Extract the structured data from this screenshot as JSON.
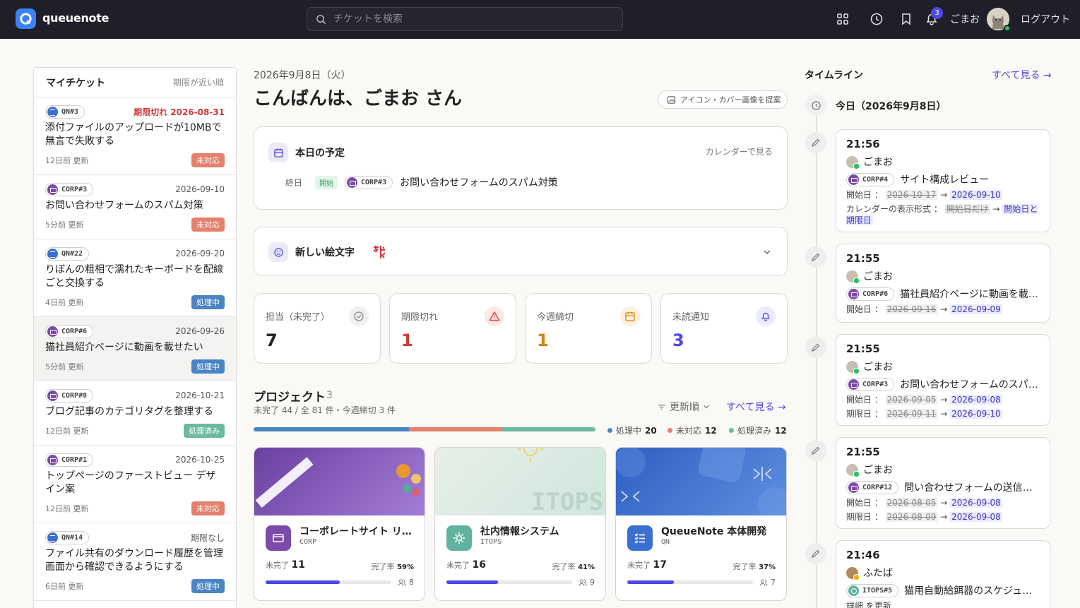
{
  "header": {
    "brand": "queuenote",
    "search_placeholder": "チケットを検索",
    "notif_count": "3",
    "user": "ごまお",
    "logout": "ログアウト"
  },
  "my_tickets": {
    "title": "マイチケット",
    "sort": "期限が近い順",
    "items": [
      {
        "code": "QN#3",
        "project": "qn",
        "date": "期限切れ 2026-08-31",
        "overdue": true,
        "title": "添付ファイルのアップロードが10MBで無言で失敗する",
        "updated": "12日前 更新",
        "status": "未対応",
        "status_kind": "todo"
      },
      {
        "code": "CORP#3",
        "project": "corp",
        "date": "2026-09-10",
        "title": "お問い合わせフォームのスパム対策",
        "updated": "5分前 更新",
        "status": "未対応",
        "status_kind": "todo"
      },
      {
        "code": "QN#22",
        "project": "qn",
        "date": "2026-09-20",
        "title": "りぼんの粗相で濡れたキーボードを配線ごと交換する",
        "updated": "4日前 更新",
        "status": "処理中",
        "status_kind": "prog"
      },
      {
        "code": "CORP#6",
        "project": "corp",
        "date": "2026-09-26",
        "title": "猫社員紹介ページに動画を載せたい",
        "updated": "5分前 更新",
        "status": "処理中",
        "status_kind": "prog",
        "active": true
      },
      {
        "code": "CORP#8",
        "project": "corp",
        "date": "2026-10-21",
        "title": "ブログ記事のカテゴリタグを整理する",
        "updated": "12日前 更新",
        "status": "処理済み",
        "status_kind": "done"
      },
      {
        "code": "CORP#1",
        "project": "corp",
        "date": "2026-10-25",
        "title": "トップページのファーストビュー デザイン案",
        "updated": "12日前 更新",
        "status": "未対応",
        "status_kind": "todo"
      },
      {
        "code": "QN#14",
        "project": "qn",
        "date": "期限なし",
        "title": "ファイル共有のダウンロード履歴を管理画面から確認できるようにする",
        "updated": "6日前 更新",
        "status": "処理中",
        "status_kind": "prog"
      }
    ]
  },
  "main": {
    "date": "2026年9月8日（火）",
    "greeting": "こんばんは、ごまお さん",
    "suggest": "アイコン・カバー画像を提案",
    "schedule": {
      "title": "本日の予定",
      "link": "カレンダーで見る",
      "event": {
        "when": "終日",
        "tag": "開始",
        "code": "CORP#3",
        "title": "お問い合わせフォームのスパム対策"
      }
    },
    "emoji": {
      "title": "新しい絵文字"
    },
    "kpis": [
      {
        "label": "担当（未完了）",
        "value": "7",
        "color": "#222222"
      },
      {
        "label": "期限切れ",
        "value": "1",
        "color": "#d03a3a"
      },
      {
        "label": "今週締切",
        "value": "1",
        "color": "#d28416"
      },
      {
        "label": "未読通知",
        "value": "3",
        "color": "#4f46e5"
      }
    ],
    "projects": {
      "title": "プロジェクト",
      "count": "3",
      "sub": "未完了 44 / 全 81 件・今週締切 3 件",
      "sort": "更新順",
      "see_all": "すべて見る →",
      "status_split": {
        "in_progress": 20,
        "todo": 12,
        "done": 12
      },
      "legend": [
        {
          "label": "処理中",
          "value": "20",
          "color": "#4a84c4"
        },
        {
          "label": "未対応",
          "value": "12",
          "color": "#e4806c"
        },
        {
          "label": "処理済み",
          "value": "12",
          "color": "#6db8a1"
        }
      ],
      "cards": [
        {
          "name": "コーポレートサイト リニューアル",
          "code": "CORP",
          "remaining_label": "未完了",
          "remaining": "11",
          "rate_label": "完了率",
          "rate": "59%",
          "progress": 0.59,
          "members": "8",
          "color": "#7c4aa8"
        },
        {
          "name": "社内情報システム",
          "code": "ITOPS",
          "remaining_label": "未完了",
          "remaining": "16",
          "rate_label": "完了率",
          "rate": "41%",
          "progress": 0.41,
          "members": "9",
          "color": "#5fb3a0"
        },
        {
          "name": "QueueNote 本体開発",
          "code": "QN",
          "remaining_label": "未完了",
          "remaining": "17",
          "rate_label": "完了率",
          "rate": "37%",
          "progress": 0.37,
          "members": "7",
          "color": "#3b6fd0"
        }
      ]
    }
  },
  "timeline": {
    "title": "タイムライン",
    "see_all": "すべて見る →",
    "today": "今日（2026年9月8日）",
    "entries": [
      {
        "time": "21:56",
        "user": "ごまお",
        "code": "CORP#4",
        "project": "corp",
        "title": "サイト構成レビュー",
        "changes": [
          {
            "label": "開始日 ：",
            "old": "2026-10-17",
            "new": "2026-09-10"
          },
          {
            "label": "カレンダーの表示形式 ：",
            "old": "開始日だけ",
            "new": "開始日と期限日"
          }
        ]
      },
      {
        "time": "21:55",
        "user": "ごまお",
        "code": "CORP#6",
        "project": "corp",
        "title": "猫社員紹介ページに動画を載せたい",
        "changes": [
          {
            "label": "開始日 ：",
            "old": "2026-09-16",
            "new": "2026-09-09"
          }
        ]
      },
      {
        "time": "21:55",
        "user": "ごまお",
        "code": "CORP#3",
        "project": "corp",
        "title": "お問い合わせフォームのスパム対策",
        "changes": [
          {
            "label": "開始日 ：",
            "old": "2026-09-05",
            "new": "2026-09-08"
          },
          {
            "label": "期限日 ：",
            "old": "2026-09-11",
            "new": "2026-09-10"
          }
        ]
      },
      {
        "time": "21:55",
        "user": "ごまお",
        "code": "CORP#12",
        "project": "corp",
        "title": "問い合わせフォームの送信完了メール",
        "changes": [
          {
            "label": "開始日 ：",
            "old": "2026-08-05",
            "new": "2026-09-08"
          },
          {
            "label": "期限日 ：",
            "old": "2026-08-09",
            "new": "2026-09-08"
          }
        ]
      },
      {
        "time": "21:46",
        "user": "ふたば",
        "code": "ITOPS#5",
        "project": "itops",
        "title": "猫用自動給餌器のスケジュール",
        "changes": [
          {
            "label": "詳細 を更新",
            "old": "",
            "new": ""
          }
        ]
      }
    ]
  }
}
